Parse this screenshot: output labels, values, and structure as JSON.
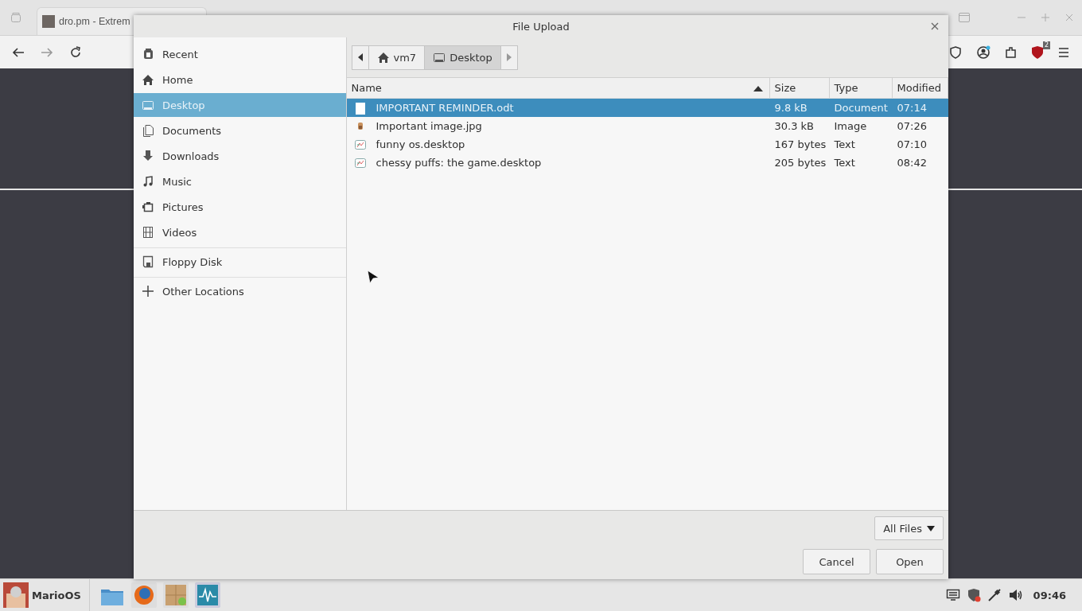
{
  "browser": {
    "tab": {
      "title": "dro.pm - Extrem"
    },
    "extension_badge": "2"
  },
  "dialog": {
    "title": "File Upload",
    "path": [
      {
        "label": "vm7",
        "kind": "home",
        "selected": false
      },
      {
        "label": "Desktop",
        "kind": "desktop",
        "selected": true
      }
    ],
    "places": [
      [
        {
          "label": "Recent",
          "kind": "recent",
          "selected": false
        },
        {
          "label": "Home",
          "kind": "home",
          "selected": false
        },
        {
          "label": "Desktop",
          "kind": "desktop",
          "selected": true
        },
        {
          "label": "Documents",
          "kind": "documents",
          "selected": false
        },
        {
          "label": "Downloads",
          "kind": "downloads",
          "selected": false
        },
        {
          "label": "Music",
          "kind": "music",
          "selected": false
        },
        {
          "label": "Pictures",
          "kind": "pictures",
          "selected": false
        },
        {
          "label": "Videos",
          "kind": "videos",
          "selected": false
        }
      ],
      [
        {
          "label": "Floppy Disk",
          "kind": "floppy",
          "selected": false
        }
      ],
      [
        {
          "label": "Other Locations",
          "kind": "other",
          "selected": false
        }
      ]
    ],
    "columns": [
      {
        "label": "Name",
        "sorted": true
      },
      {
        "label": "Size",
        "sorted": false
      },
      {
        "label": "Type",
        "sorted": false
      },
      {
        "label": "Modified",
        "sorted": false
      }
    ],
    "rows": [
      {
        "name": "IMPORTANT REMINDER.odt",
        "size": "9.8 kB",
        "type": "Document",
        "modified": "07:14",
        "kind": "document",
        "selected": true
      },
      {
        "name": "Important image.jpg",
        "size": "30.3 kB",
        "type": "Image",
        "modified": "07:26",
        "kind": "image",
        "selected": false
      },
      {
        "name": "funny os.desktop",
        "size": "167 bytes",
        "type": "Text",
        "modified": "07:10",
        "kind": "launcher",
        "selected": false
      },
      {
        "name": "chessy puffs: the game.desktop",
        "size": "205 bytes",
        "type": "Text",
        "modified": "08:42",
        "kind": "launcher",
        "selected": false
      }
    ],
    "filter": "All Files",
    "buttons": [
      "Cancel",
      "Open"
    ]
  },
  "taskbar": {
    "start_label": "MarioOS",
    "clock": "09:46"
  }
}
